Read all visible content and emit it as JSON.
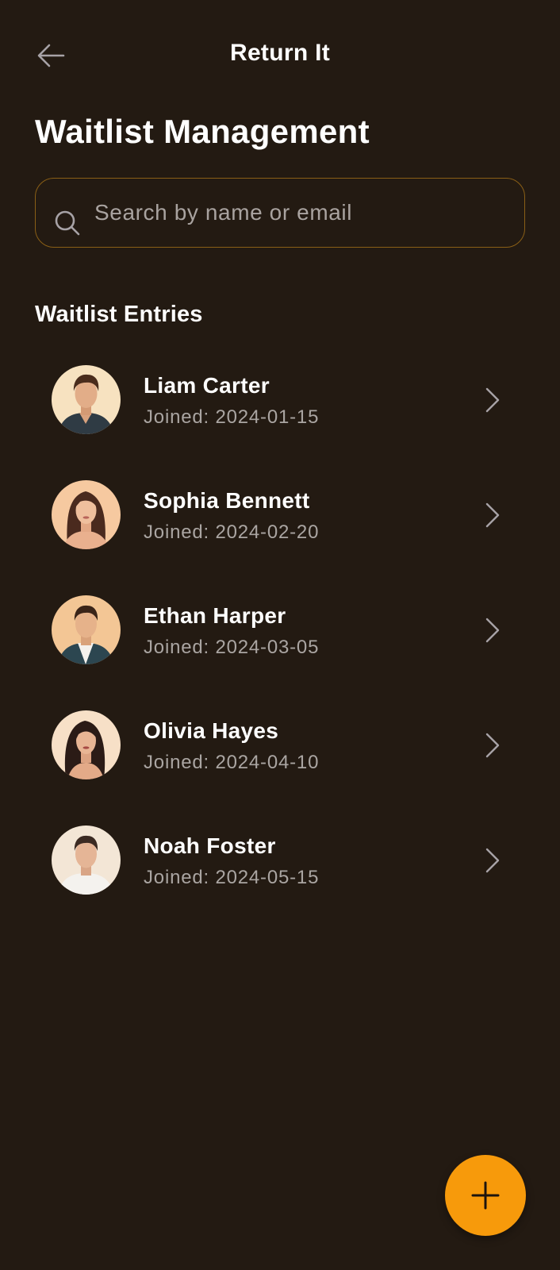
{
  "header": {
    "app_title": "Return It",
    "back_icon": "arrow-left-icon"
  },
  "page": {
    "title": "Waitlist Management"
  },
  "search": {
    "placeholder": "Search by name or email",
    "value": "",
    "icon": "search-icon"
  },
  "entries_section": {
    "title": "Waitlist Entries",
    "items": [
      {
        "name": "Liam Carter",
        "joined": "Joined: 2024-01-15"
      },
      {
        "name": "Sophia Bennett",
        "joined": "Joined: 2024-02-20"
      },
      {
        "name": "Ethan Harper",
        "joined": "Joined: 2024-03-05"
      },
      {
        "name": "Olivia Hayes",
        "joined": "Joined: 2024-04-10"
      },
      {
        "name": "Noah Foster",
        "joined": "Joined: 2024-05-15"
      }
    ]
  },
  "fab": {
    "icon": "plus-icon"
  },
  "colors": {
    "background": "#231a12",
    "accent": "#f79a0b",
    "search_border": "#8a5f16",
    "muted_text": "#aaa5a2"
  }
}
